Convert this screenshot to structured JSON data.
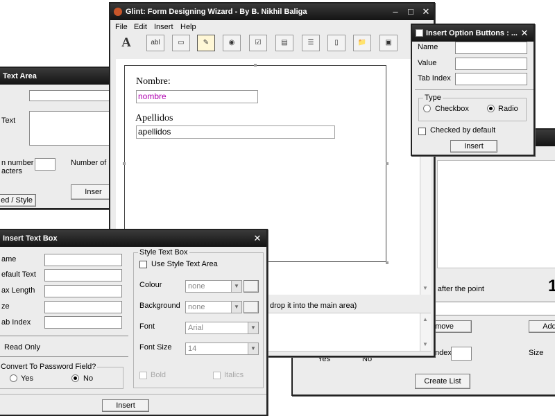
{
  "text_area_win": {
    "title": "Text Area",
    "text_label": "Text",
    "min_number_label_1": "n number",
    "min_number_label_2": "acters",
    "num_lines_label": "Number of li",
    "insert_label": "Inser",
    "style_label": "ed / Style"
  },
  "main": {
    "title": "Glint: Form Designing Wizard - By B. Nikhil Baliga",
    "menu": [
      "File",
      "Edit",
      "Insert",
      "Help"
    ],
    "toolbar": [
      "A",
      "abl",
      "",
      "",
      "",
      "",
      "",
      "",
      "",
      "",
      "",
      ""
    ],
    "canvas": {
      "nombre_label": "Nombre:",
      "nombre_value": "nombre",
      "apellidos_label": "Apellidos",
      "apellidos_value": "apellidos"
    },
    "hint_text": "drop it into the main area)"
  },
  "option_buttons": {
    "title": "Insert Option Buttons : ...",
    "name_label": "Name",
    "value_label": "Value",
    "tab_index_label": "Tab Index",
    "type_label": "Type",
    "checkbox_label": "Checkbox",
    "radio_label": "Radio",
    "checked_default_label": "Checked by default",
    "insert_label": "Insert"
  },
  "list_win": {
    "after_point_label": "r after the point",
    "digit": "1",
    "remove_label": "emove",
    "add_label": "Add",
    "yes_label": "Yes",
    "no_label": "No",
    "index_label": "ndex",
    "size_label": "Size",
    "create_list_label": "Create List"
  },
  "text_box_win": {
    "title": "Insert Text Box",
    "name_label": "ame",
    "default_text_label": "efault Text",
    "max_length_label": "ax Length",
    "size_label": "ze",
    "tab_index_label": "ab Index",
    "read_only_label": "Read Only",
    "password_label": "Convert To Password Field?",
    "yes_label": "Yes",
    "no_label": "No",
    "insert_label": "Insert",
    "style": {
      "group_label": "Style Text Box",
      "use_style_label": "Use Style Text Area",
      "colour_label": "Colour",
      "colour_value": "none",
      "background_label": "Background",
      "background_value": "none",
      "font_label": "Font",
      "font_value": "Arial",
      "font_size_label": "Font Size",
      "font_size_value": "14",
      "bold_label": "Bold",
      "italics_label": "Italics"
    }
  },
  "colors": {
    "title_bar": "#1e1e1e",
    "window_bg": "#ececec",
    "nombre_text": "#b000b0"
  }
}
